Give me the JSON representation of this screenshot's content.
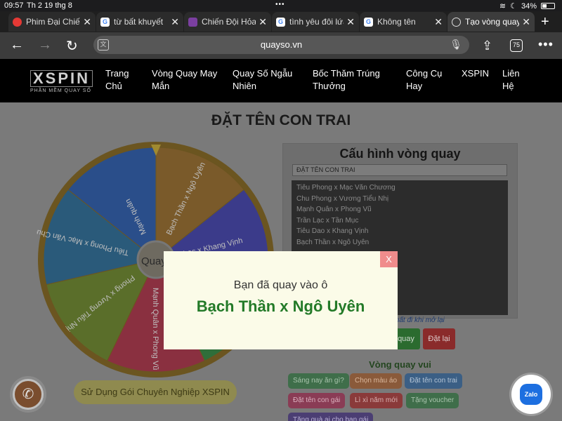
{
  "status": {
    "time": "09:57",
    "date": "Th 2 19 thg 8",
    "battery": "34%"
  },
  "tabs": [
    {
      "title": "Phim Đại Chiến",
      "icon": "red-circle-icon"
    },
    {
      "title": "từ bất khuyết",
      "icon": "google-icon"
    },
    {
      "title": "Chiến Đội Hỏa",
      "icon": "purple-icon"
    },
    {
      "title": "tình yêu đôi lứa",
      "icon": "google-icon"
    },
    {
      "title": "Không tên",
      "icon": "google-icon"
    },
    {
      "title": "Tạo vòng quay",
      "icon": "globe-icon"
    }
  ],
  "address": {
    "url": "quayso.vn",
    "tab_count": "75"
  },
  "site_nav": {
    "logo": "XSPIN",
    "logo_sub": "PHẦN MỀM QUAY SỐ",
    "items": [
      {
        "line1": "Trang",
        "line2": "Chủ"
      },
      {
        "line1": "Vòng Quay May",
        "line2": "Mắn"
      },
      {
        "line1": "Quay Số Ngẫu",
        "line2": "Nhiên"
      },
      {
        "line1": "Bốc Thăm Trúng",
        "line2": "Thưởng"
      },
      {
        "line1": "Công Cụ",
        "line2": "Hay"
      },
      {
        "line1": "XSPIN",
        "line2": ""
      },
      {
        "line1": "Liên",
        "line2": "Hệ"
      }
    ]
  },
  "page": {
    "title": "ĐẶT TÊN CON TRAI",
    "wheel_center": "Quay",
    "wheel_labels": [
      {
        "text": "Bạch Thần x Ngô Uyên",
        "color": "#7a5a2a"
      },
      {
        "text": "Lạc x Khang Vịnh",
        "color": "#3b3b8a"
      },
      {
        "text": "Trần Lạc x Tần Mục",
        "color": "#2f6e3a"
      },
      {
        "text": "Mạnh Quân x Phong Vũ",
        "color": "#8a3040"
      },
      {
        "text": "Phong x Vương Tiểu Nhị",
        "color": "#5a6e2a"
      },
      {
        "text": "Tiêu Phong x Mạc Văn Chương",
        "color": "#2a5a7a"
      },
      {
        "text": "Mạnh quân",
        "color": "#2a4e8a"
      }
    ],
    "pro_button": "Sử Dụng Gói Chuyên Nghiệp XSPIN",
    "config": {
      "title": "Cấu hình vòng quay",
      "input_value": "ĐẶT TÊN CON TRAI",
      "entries": [
        "Tiêu Phong x Mạc Văn Chương",
        "Chu Phong x Vương Tiểu Nhị",
        "Mạnh Quân x Phong Vũ",
        "Trần Lạc x Tần Mục",
        "Tiêu Dao x Khang Vịnh",
        "Bạch Thần x Ngô Uyên"
      ],
      "note": "mất đi khi mở lại",
      "spin_label": "quay",
      "reset_label": "Đặt lại"
    },
    "fun_title": "Vòng quay vui",
    "chips": [
      "Sáng nay ăn gì?",
      "Chọn màu áo",
      "Đặt tên con trai",
      "Đặt tên con gái",
      "Lì xì năm mới",
      "Tặng voucher",
      "Tặng quà ai cho bạn gái"
    ],
    "zalo": "Zalo"
  },
  "modal": {
    "close": "X",
    "label": "Bạn đã quay vào ô",
    "result": "Bạch Thần x Ngô Uyên"
  }
}
